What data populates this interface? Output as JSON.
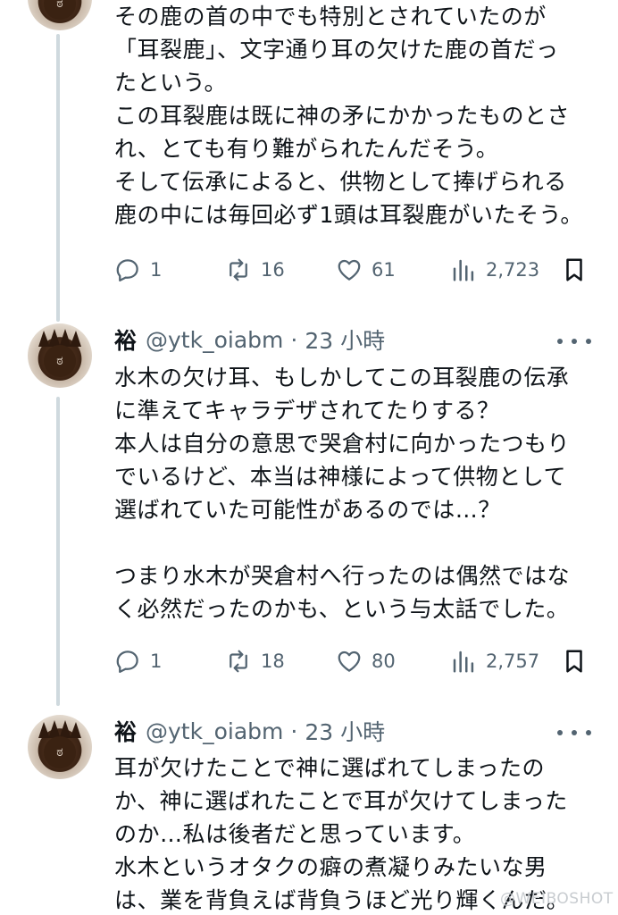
{
  "tweets": [
    {
      "text": "その鹿の首の中でも特別とされていたのが\n「耳裂鹿」、文字通り耳の欠けた鹿の首だっ\nたという。\nこの耳裂鹿は既に神の矛にかかったものとさ\nれ、とても有り難がられたんだそう。\nそして伝承によると、供物として捧げられる\n鹿の中には毎回必ず1頭は耳裂鹿がいたそう。",
      "reply_count": "1",
      "retweet_count": "16",
      "like_count": "61",
      "view_count": "2,723"
    },
    {
      "author_name": "裕",
      "handle": "@ytk_oiabm",
      "separator": "·",
      "time": "23 小時",
      "text": "水木の欠け耳、もしかしてこの耳裂鹿の伝承\nに準えてキャラデザされてたりする？\n本人は自分の意思で哭倉村に向かったつもり\nでいるけど、本当は神様によって供物として\n選ばれていた可能性があるのでは…？\n\nつまり水木が哭倉村へ行ったのは偶然ではな\nく必然だったのかも、という与太話でした。",
      "reply_count": "1",
      "retweet_count": "18",
      "like_count": "80",
      "view_count": "2,757"
    },
    {
      "author_name": "裕",
      "handle": "@ytk_oiabm",
      "separator": "·",
      "time": "23 小時",
      "text": "耳が欠けたことで神に選ばれてしまったの\nか、神に選ばれたことで耳が欠けてしまった\nのか…私は後者だと思っています。\n水木というオタクの癖の煮凝りみたいな男\nは、業を背負えば背負うほど光り輝くんだ。"
    }
  ],
  "avatar_glyph": "ಠ",
  "watermark": "@WEIBOSHOT",
  "icons": {
    "reply": "reply-icon",
    "retweet": "retweet-icon",
    "like": "like-icon",
    "views": "views-icon",
    "bookmark": "bookmark-icon",
    "more": "more-icon"
  },
  "colors": {
    "text": "#0f1419",
    "secondary": "#536471",
    "thread_line": "#cfd9de"
  }
}
